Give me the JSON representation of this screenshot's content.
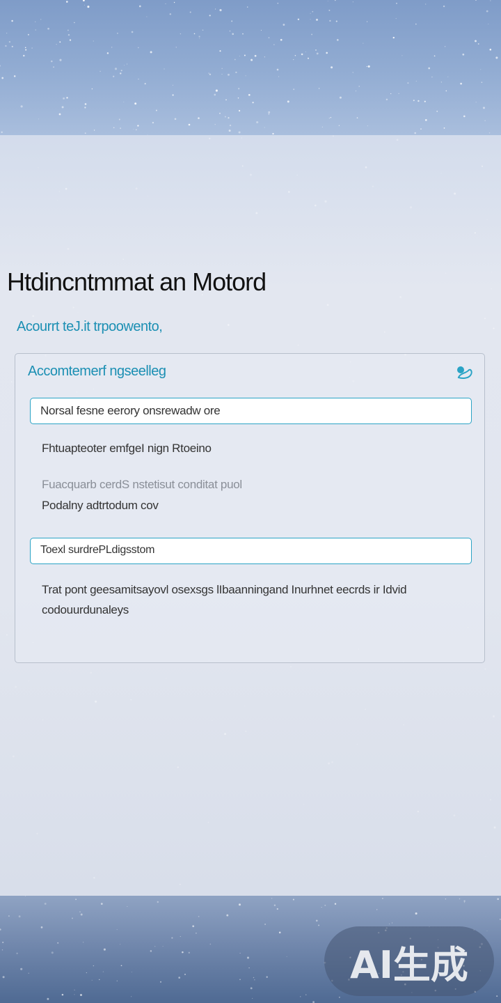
{
  "page": {
    "title": "Htdincntmmat an Motord",
    "subtitle": "Acourrt teJ.it trpoowento,"
  },
  "panel": {
    "title": "Accomtemerf ngseelleg",
    "icon": "search-person-icon",
    "field1": {
      "value": "Norsal fesne eerory onsrewadw ore"
    },
    "line1": "Fhtuapteoter emfgeI nign Rtoeino",
    "line2": "Fuacquarb cerdS nstetisut conditat puol",
    "line3": "Podalny adtrtodum cov",
    "field2": {
      "value": "Toexl surdrePLdigsstom"
    },
    "line4": "Trat pont geesamitsayovl osexsgs lIbaanningand Inurhnet eecrds ir Idvid",
    "line5": "codouurdunaleys"
  },
  "watermark": {
    "text": "AI生成"
  },
  "colors": {
    "accent": "#1b8fb3",
    "field_border": "#2aa3c5",
    "sky_top": "#7f9cc8",
    "sky_bottom": "#4f6a93"
  }
}
